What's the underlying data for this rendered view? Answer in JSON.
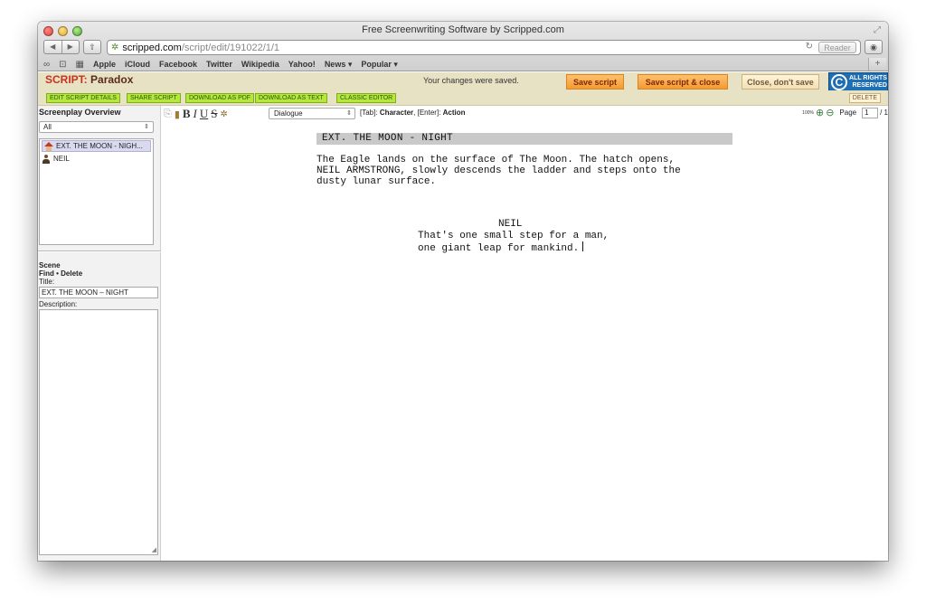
{
  "browser": {
    "title": "Free Screenwriting Software by Scripped.com",
    "url_domain": "scripped.com",
    "url_path": "/script/edit/191022/1/1",
    "reader_label": "Reader",
    "bookmarks": [
      "Apple",
      "iCloud",
      "Facebook",
      "Twitter",
      "Wikipedia",
      "Yahoo!",
      "News ▾",
      "Popular ▾"
    ]
  },
  "header": {
    "script_label": "SCRIPT:",
    "script_name": "Paradox",
    "saved_message": "Your changes were saved.",
    "save_script": "Save script",
    "save_close": "Save script & close",
    "close_nosave": "Close, don't save",
    "copyright_line1": "ALL RIGHTS",
    "copyright_line2": "RESERVED"
  },
  "actions": {
    "edit_details": "EDIT SCRIPT DETAILS",
    "share": "SHARE SCRIPT",
    "download_pdf": "DOWNLOAD AS PDF",
    "download_text": "DOWNLOAD AS TEXT",
    "classic_editor": "CLASSIC EDITOR",
    "delete": "DELETE"
  },
  "sidebar": {
    "title": "Screenplay Overview",
    "filter": "All",
    "items": [
      {
        "label": "EXT. THE MOON - NIGH...",
        "icon": "house-icon"
      },
      {
        "label": "NEIL",
        "icon": "person-icon"
      }
    ],
    "scene_heading": "Scene",
    "find": "Find",
    "delete": "Delete",
    "title_label": "Title:",
    "title_value": "EXT. THE MOON – NIGHT",
    "description_label": "Description:"
  },
  "toolbar": {
    "element_type": "Dialogue",
    "hint_tab": "[Tab]:",
    "hint_tab_value": "Character",
    "hint_enter": "[Enter]:",
    "hint_enter_value": "Action",
    "zoom": "100%",
    "page_label": "Page",
    "page_value": "1",
    "page_total": "/ 1"
  },
  "script": {
    "slugline": "EXT. THE MOON - NIGHT",
    "action": "The Eagle lands on the surface of The Moon. The hatch opens,\nNEIL ARMSTRONG, slowly descends the ladder and steps onto the\ndusty lunar surface.",
    "character": "NEIL",
    "dialogue": "That's one small step for a man,\none giant leap for mankind."
  }
}
